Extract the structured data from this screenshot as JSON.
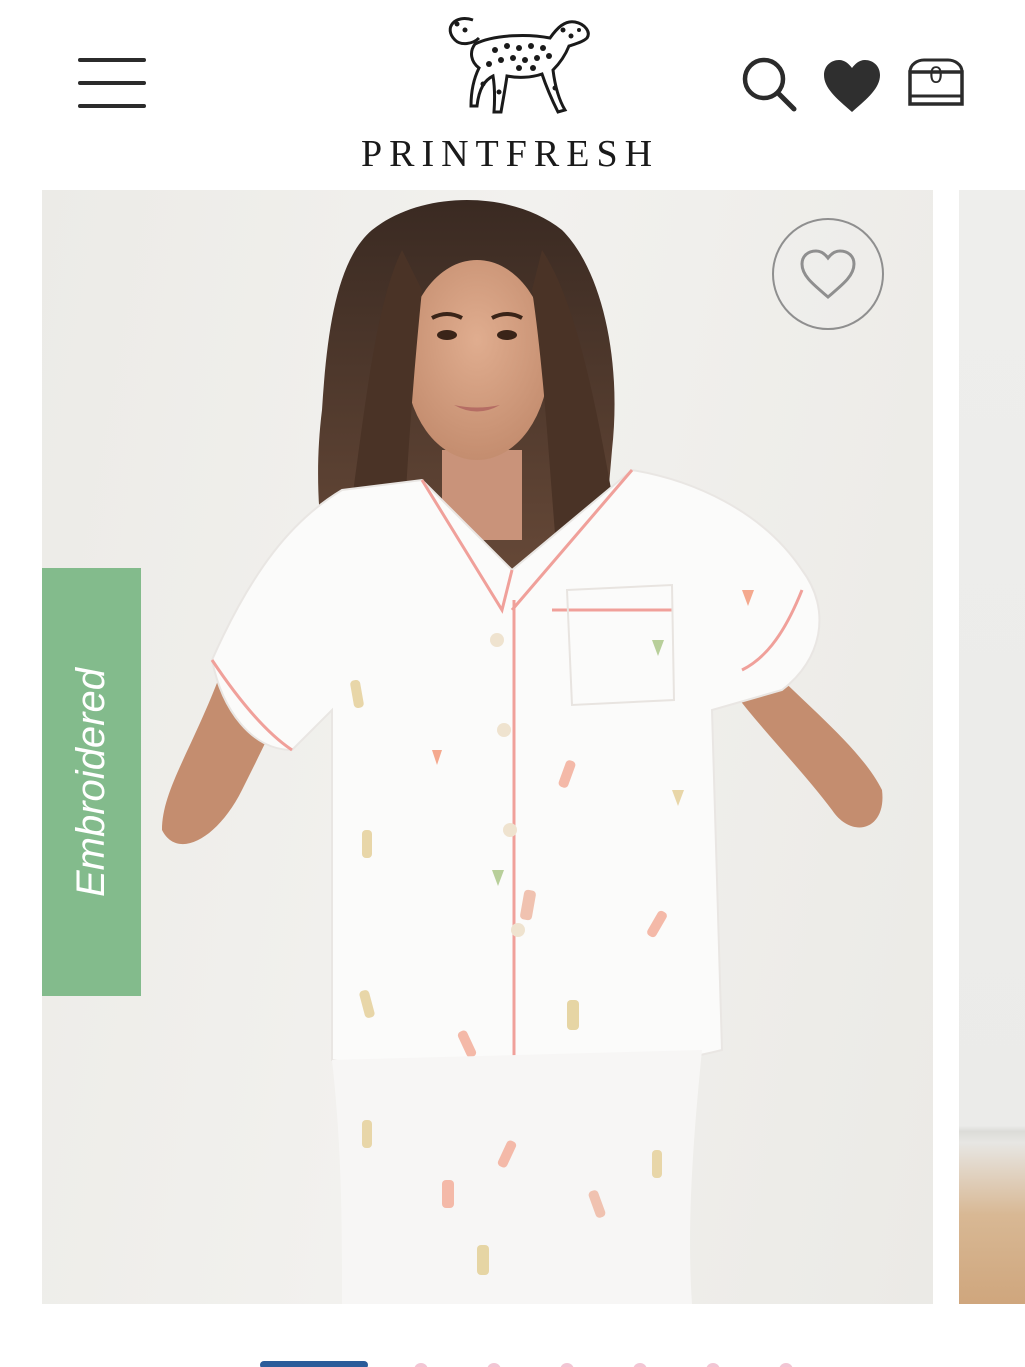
{
  "header": {
    "brand_name": "PRINTFRESH",
    "cart_count": "0",
    "icons": {
      "menu": "hamburger-icon",
      "search": "search-icon",
      "favorites": "heart-filled-icon",
      "bag": "shopping-bag-icon",
      "logo": "cheetah-logo"
    }
  },
  "product_image": {
    "badge_label": "Embroidered",
    "badge_color": "#83bb8c",
    "wishlist_icon": "heart-outline-icon",
    "description_subject": "woman in white short-sleeve embroidered pajama set"
  },
  "pagination": {
    "active_color": "#2a5c9a",
    "inactive_color": "#f2c6d4",
    "total_dots": 7,
    "active_index": 0
  }
}
